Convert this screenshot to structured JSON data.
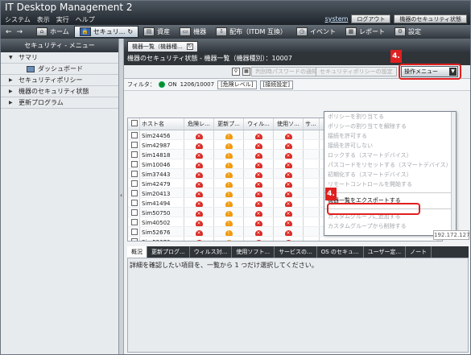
{
  "app": {
    "title": "IT Desktop Management 2",
    "menu": [
      "システム",
      "表示",
      "実行",
      "ヘルプ"
    ],
    "top_links": {
      "system": "system",
      "logout": "ログアウト",
      "security_status": "機器のセキュリティ状態"
    }
  },
  "toolbar": {
    "back_icon": "back-arrow-icon",
    "forward_icon": "forward-arrow-icon",
    "items": [
      "ホーム",
      "セキュリ...",
      "資産",
      "機器",
      "配布（ITDM 互換）",
      "イベント",
      "レポート",
      "設定"
    ]
  },
  "sidebar": {
    "header": "セキュリティ - メニュー",
    "items": [
      {
        "label": "サマリ",
        "expanded": true
      },
      {
        "label": "ダッシュボード",
        "child": true
      },
      {
        "label": "セキュリティポリシー",
        "expanded": false
      },
      {
        "label": "機器のセキュリティ状態",
        "expanded": false
      },
      {
        "label": "更新プログラム",
        "expanded": false
      }
    ]
  },
  "main": {
    "tab": "機器一覧（機器種...",
    "headline": "機器のセキュリティ状態 - 機器一覧（機器種別）：10007",
    "disabled_actions": [
      "判別時パスワードの通知",
      "セキュリティポリシーの設定"
    ],
    "operation_menu": "操作メニュー",
    "callout": "4.",
    "filter": {
      "label": "フィルタ：",
      "state": "ON",
      "count": "1206/10007",
      "risk_level": "[危険レベル]",
      "connection_setting": "[接続設定]"
    },
    "columns": [
      "ホスト名",
      "危険レ...",
      "更新プ...",
      "ウィル...",
      "使用ソ...",
      "サ..."
    ],
    "rows": [
      {
        "host": "Sim24456",
        "status": [
          "red",
          "orange",
          "red",
          "red"
        ]
      },
      {
        "host": "Sim42987",
        "status": [
          "red",
          "orange",
          "red",
          "red"
        ]
      },
      {
        "host": "Sim14818",
        "status": [
          "red",
          "orange",
          "red",
          "red"
        ]
      },
      {
        "host": "Sim10046",
        "status": [
          "red",
          "orange",
          "red",
          "red"
        ]
      },
      {
        "host": "Sim37443",
        "status": [
          "red",
          "orange",
          "red",
          "red"
        ]
      },
      {
        "host": "Sim42479",
        "status": [
          "red",
          "orange",
          "red",
          "red"
        ]
      },
      {
        "host": "Sim20413",
        "status": [
          "red",
          "orange",
          "red",
          "red"
        ]
      },
      {
        "host": "Sim41494",
        "status": [
          "red",
          "orange",
          "red",
          "red"
        ]
      },
      {
        "host": "Sim50750",
        "status": [
          "red",
          "orange",
          "red",
          "red"
        ]
      },
      {
        "host": "Sim40502",
        "status": [
          "red",
          "orange",
          "red",
          "red"
        ]
      },
      {
        "host": "Sim52676",
        "status": [
          "red",
          "orange",
          "red",
          "red"
        ]
      },
      {
        "host": "Sim52676",
        "status": [
          "red",
          "orange",
          "red",
          "red"
        ]
      }
    ],
    "menu_items": [
      {
        "label": "ポリシーを割り当てる",
        "enabled": false
      },
      {
        "label": "ポリシーの割り当てを解除する",
        "enabled": false
      },
      {
        "label": "接続を許可する",
        "enabled": false
      },
      {
        "label": "接続を許可しない",
        "enabled": false
      },
      {
        "label": "ロックする（スマートデバイス）",
        "enabled": false
      },
      {
        "label": "パスコードをリセットする（スマートデバイス）",
        "enabled": false
      },
      {
        "label": "初期化する（スマートデバイス）",
        "enabled": false
      },
      {
        "label": "リモートコントロールを開始する",
        "enabled": false
      },
      {
        "label": "機器一覧をエクスポートする",
        "enabled": true
      },
      {
        "label": "カスタムグループに追加する",
        "enabled": false
      },
      {
        "label": "カスタムグループから削除する",
        "enabled": false
      }
    ],
    "ip_value": "192.172.127.1",
    "details_tabs": [
      "概況",
      "更新プログ...",
      "ウィルス対...",
      "使用ソフト...",
      "サービスの...",
      "OS のセキュ...",
      "ユーザー定...",
      "ノート"
    ],
    "details_text": "詳細を確認したい項目を、一覧から 1 つだけ選択してください。"
  }
}
